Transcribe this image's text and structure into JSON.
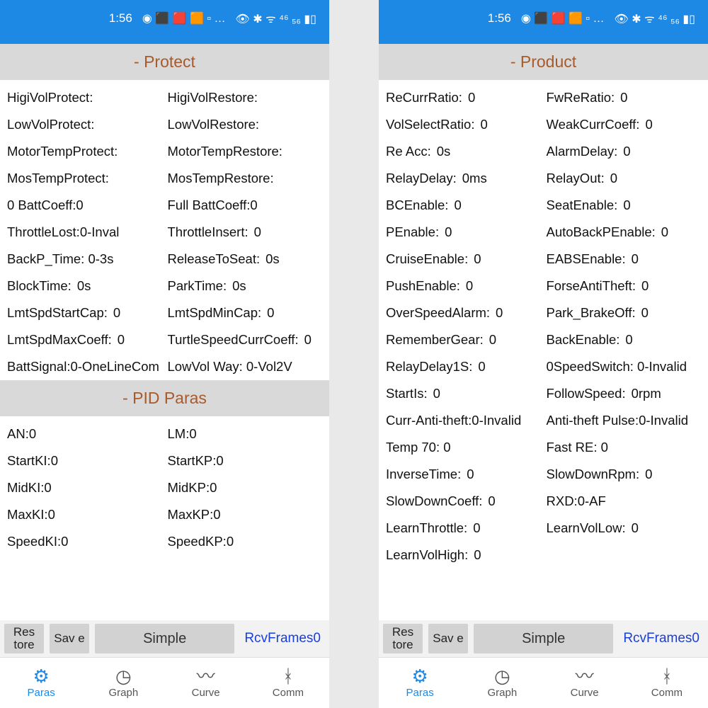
{
  "status": {
    "time": "1:56",
    "tray": "◉ ⬛ 🟥 🟧 ▫ …",
    "signal": "👁 ✱ ᯤ ⁴⁶ ₅₆ ▮▯"
  },
  "left": {
    "sections": [
      {
        "title": "- Protect",
        "rows": [
          [
            {
              "l": "HigiVolProtect:",
              "v": ""
            },
            {
              "l": "HigiVolRestore:",
              "v": ""
            }
          ],
          [
            {
              "l": "LowVolProtect:",
              "v": ""
            },
            {
              "l": "LowVolRestore:",
              "v": ""
            }
          ],
          [
            {
              "l": "MotorTempProtect:",
              "v": ""
            },
            {
              "l": "MotorTempRestore:",
              "v": ""
            }
          ],
          [
            {
              "l": "MosTempProtect:",
              "v": ""
            },
            {
              "l": "MosTempRestore:",
              "v": ""
            }
          ],
          [
            {
              "l": "0 BattCoeff:0",
              "v": ""
            },
            {
              "l": "Full BattCoeff:0",
              "v": ""
            }
          ],
          [
            {
              "l": "ThrottleLost:0-Inval",
              "v": ""
            },
            {
              "l": "ThrottleInsert:",
              "v": "0"
            }
          ],
          [
            {
              "l": "BackP_Time: 0-3s",
              "v": ""
            },
            {
              "l": "ReleaseToSeat:",
              "v": "0s"
            }
          ],
          [
            {
              "l": "BlockTime:",
              "v": "0s"
            },
            {
              "l": "ParkTime:",
              "v": "0s"
            }
          ],
          [
            {
              "l": "LmtSpdStartCap:",
              "v": "0"
            },
            {
              "l": "LmtSpdMinCap:",
              "v": "0"
            }
          ],
          [
            {
              "l": "LmtSpdMaxCoeff:",
              "v": "0"
            },
            {
              "l": "TurtleSpeedCurrCoeff:",
              "v": "0"
            }
          ],
          [
            {
              "l": "BattSignal:0-OneLineCom",
              "v": ""
            },
            {
              "l": "LowVol Way: 0-Vol2V",
              "v": ""
            }
          ]
        ]
      },
      {
        "title": "- PID Paras",
        "rows": [
          [
            {
              "l": "AN:0",
              "v": ""
            },
            {
              "l": "LM:0",
              "v": ""
            }
          ],
          [
            {
              "l": "StartKI:0",
              "v": ""
            },
            {
              "l": "StartKP:0",
              "v": ""
            }
          ],
          [
            {
              "l": "MidKI:0",
              "v": ""
            },
            {
              "l": "MidKP:0",
              "v": ""
            }
          ],
          [
            {
              "l": "MaxKI:0",
              "v": ""
            },
            {
              "l": "MaxKP:0",
              "v": ""
            }
          ],
          [
            {
              "l": "SpeedKI:0",
              "v": ""
            },
            {
              "l": "SpeedKP:0",
              "v": ""
            }
          ]
        ]
      }
    ]
  },
  "right": {
    "sections": [
      {
        "title": "- Product",
        "rows": [
          [
            {
              "l": "ReCurrRatio:",
              "v": "0"
            },
            {
              "l": "FwReRatio:",
              "v": "0"
            }
          ],
          [
            {
              "l": "VolSelectRatio:",
              "v": "0"
            },
            {
              "l": "WeakCurrCoeff:",
              "v": "0"
            }
          ],
          [
            {
              "l": "Re Acc:",
              "v": "0s"
            },
            {
              "l": "AlarmDelay:",
              "v": "0"
            }
          ],
          [
            {
              "l": "RelayDelay:",
              "v": "0ms"
            },
            {
              "l": "RelayOut:",
              "v": "0"
            }
          ],
          [
            {
              "l": "BCEnable:",
              "v": "0"
            },
            {
              "l": "SeatEnable:",
              "v": "0"
            }
          ],
          [
            {
              "l": "PEnable:",
              "v": "0"
            },
            {
              "l": "AutoBackPEnable:",
              "v": "0"
            }
          ],
          [
            {
              "l": "CruiseEnable:",
              "v": "0"
            },
            {
              "l": "EABSEnable:",
              "v": "0"
            }
          ],
          [
            {
              "l": "PushEnable:",
              "v": "0"
            },
            {
              "l": "ForseAntiTheft:",
              "v": "0"
            }
          ],
          [
            {
              "l": "OverSpeedAlarm:",
              "v": "0"
            },
            {
              "l": "Park_BrakeOff:",
              "v": "0"
            }
          ],
          [
            {
              "l": "RememberGear:",
              "v": "0"
            },
            {
              "l": "BackEnable:",
              "v": "0"
            }
          ],
          [
            {
              "l": "RelayDelay1S:",
              "v": "0"
            },
            {
              "l": "0SpeedSwitch: 0-Invalid",
              "v": ""
            }
          ],
          [
            {
              "l": "StartIs:",
              "v": "0"
            },
            {
              "l": "FollowSpeed:",
              "v": "0rpm"
            }
          ],
          [
            {
              "l": "Curr-Anti-theft:0-Invalid",
              "v": ""
            },
            {
              "l": "Anti-theft Pulse:0-Invalid",
              "v": ""
            }
          ],
          [
            {
              "l": "Temp 70: 0",
              "v": ""
            },
            {
              "l": "Fast RE: 0",
              "v": ""
            }
          ],
          [
            {
              "l": "InverseTime:",
              "v": "0"
            },
            {
              "l": "SlowDownRpm:",
              "v": "0"
            }
          ],
          [
            {
              "l": "SlowDownCoeff:",
              "v": "0"
            },
            {
              "l": "RXD:0-AF",
              "v": ""
            }
          ],
          [
            {
              "l": "LearnThrottle:",
              "v": "0"
            },
            {
              "l": "LearnVolLow:",
              "v": "0"
            }
          ],
          [
            {
              "l": "LearnVolHigh:",
              "v": "0"
            },
            {
              "l": "",
              "v": ""
            }
          ]
        ]
      }
    ]
  },
  "bottom": {
    "restore": "Res\ntore",
    "save": "Sav\ne",
    "simple": "Simple",
    "rcv": "RcvFrames0"
  },
  "nav": {
    "paras": "Paras",
    "graph": "Graph",
    "curve": "Curve",
    "comm": "Comm"
  }
}
